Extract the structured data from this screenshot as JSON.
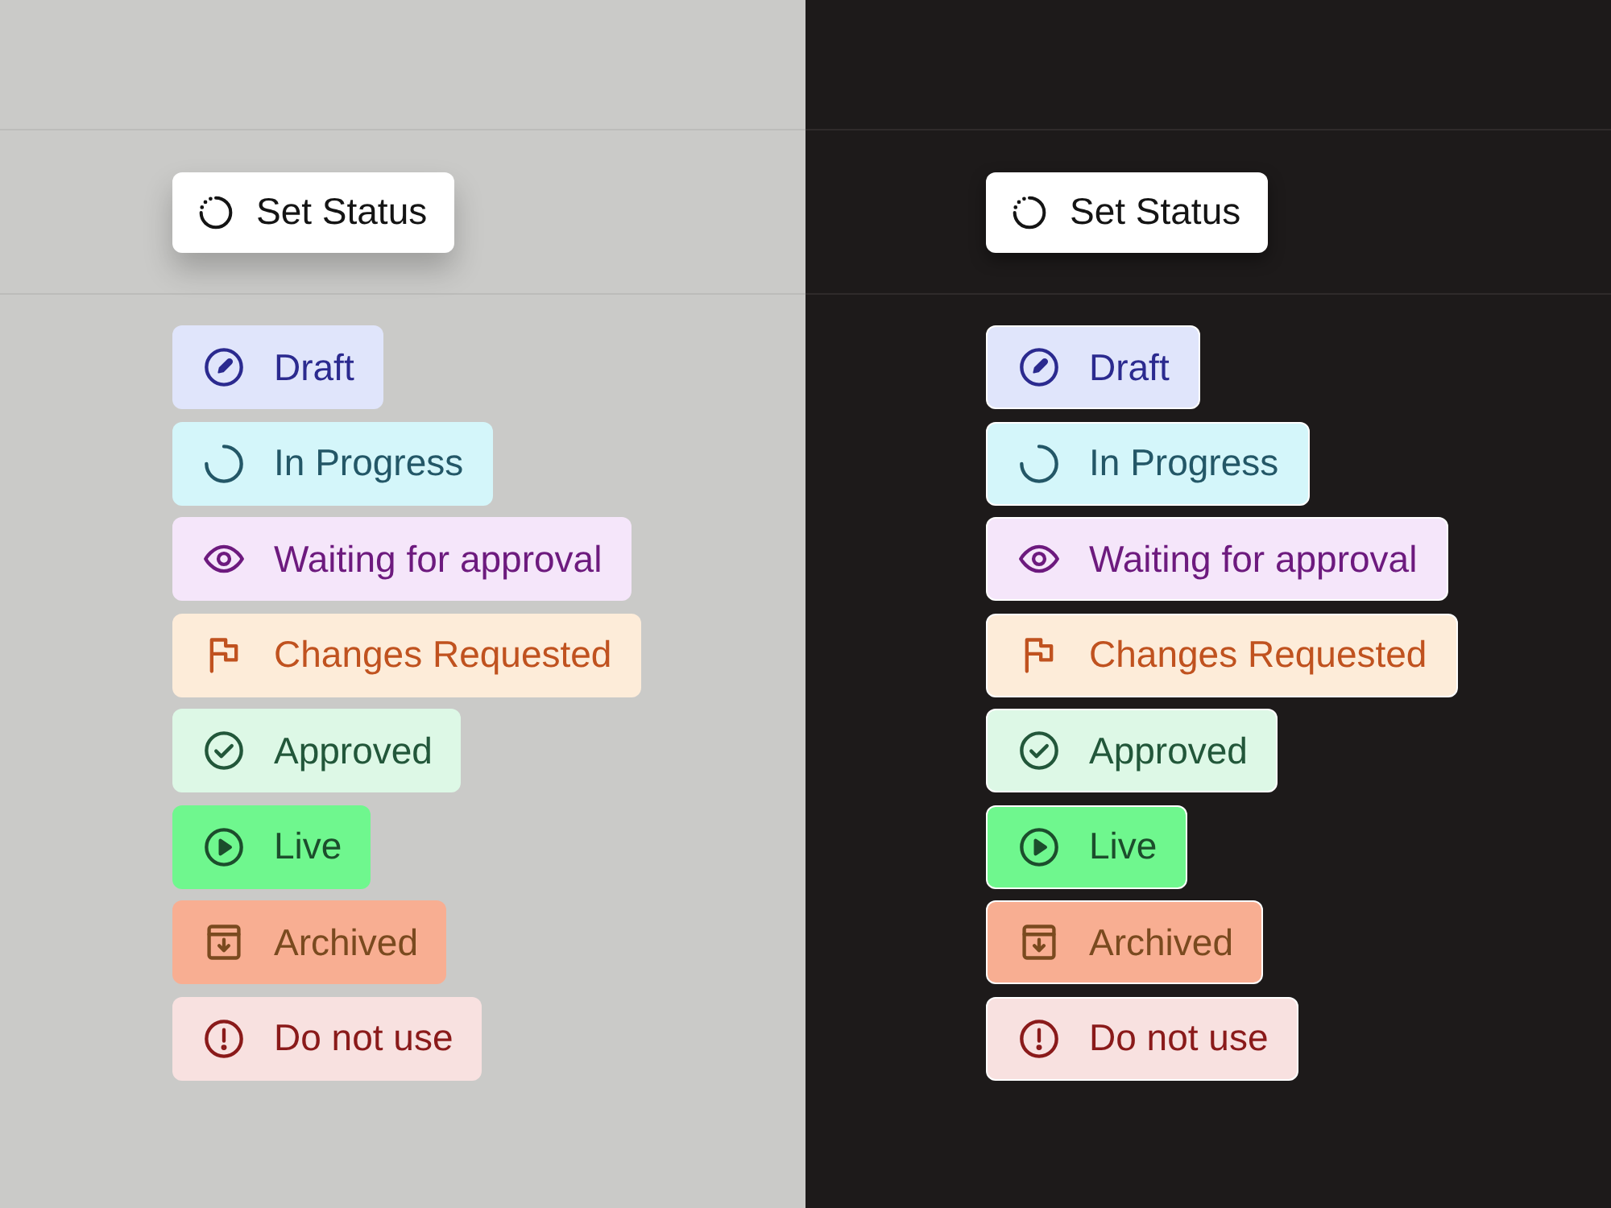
{
  "panels": [
    {
      "dark": false,
      "button": {
        "label": "Set Status"
      },
      "statuses": [
        {
          "kind": "draft",
          "label": "Draft",
          "color": "#e0e5fb"
        },
        {
          "kind": "progress",
          "label": "In Progress",
          "color": "#d4f6fa"
        },
        {
          "kind": "waiting",
          "label": "Waiting for approval",
          "color": "#f5e6fa"
        },
        {
          "kind": "changes",
          "label": "Changes Requested",
          "color": "#fdecd9"
        },
        {
          "kind": "approved",
          "label": "Approved",
          "color": "#ddf8e6"
        },
        {
          "kind": "live",
          "label": "Live",
          "color": "#6ff78e"
        },
        {
          "kind": "archived",
          "label": "Archived",
          "color": "#f8ae92"
        },
        {
          "kind": "blocked",
          "label": "Do not use",
          "color": "#f8e1e0"
        }
      ]
    },
    {
      "dark": true,
      "button": {
        "label": "Set Status"
      },
      "statuses": [
        {
          "kind": "draft",
          "label": "Draft",
          "color": "#e0e5fb"
        },
        {
          "kind": "progress",
          "label": "In Progress",
          "color": "#d4f6fa"
        },
        {
          "kind": "waiting",
          "label": "Waiting for approval",
          "color": "#f5e6fa"
        },
        {
          "kind": "changes",
          "label": "Changes Requested",
          "color": "#fdecd9"
        },
        {
          "kind": "approved",
          "label": "Approved",
          "color": "#ddf8e6"
        },
        {
          "kind": "live",
          "label": "Live",
          "color": "#6ff78e"
        },
        {
          "kind": "archived",
          "label": "Archived",
          "color": "#f8ae92"
        },
        {
          "kind": "blocked",
          "label": "Do not use",
          "color": "#f8e1e0"
        }
      ]
    }
  ]
}
